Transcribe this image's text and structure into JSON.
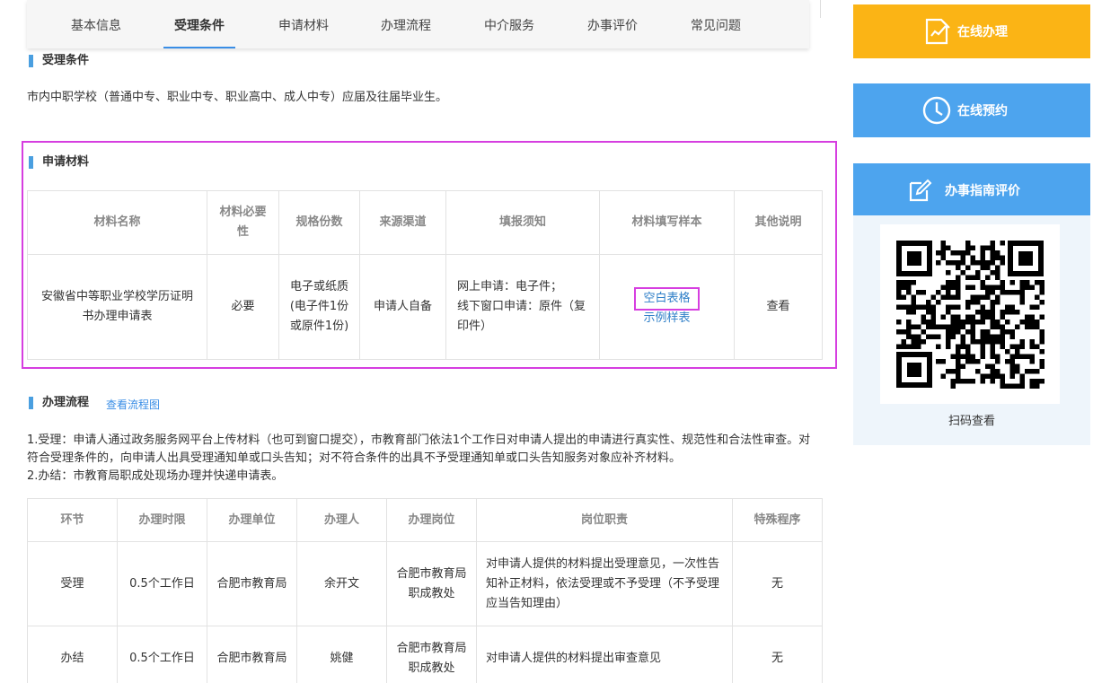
{
  "tabs": [
    "基本信息",
    "受理条件",
    "申请材料",
    "办理流程",
    "中介服务",
    "办事评价",
    "常见问题"
  ],
  "conditions": {
    "title": "受理条件",
    "text": "市内中职学校（普通中专、职业中专、职业高中、成人中专）应届及往届毕业生。"
  },
  "materials": {
    "title": "申请材料",
    "headers": [
      "材料名称",
      "材料必要性",
      "规格份数",
      "来源渠道",
      "填报须知",
      "材料填写样本",
      "其他说明"
    ],
    "row": {
      "name": "安徽省中等职业学校学历证明书办理申请表",
      "necessity": "必要",
      "spec": "电子或纸质(电子件1份或原件1份)",
      "source": "申请人自备",
      "notice_line1": "网上申请：电子件；",
      "notice_line2": "线下窗口申请：原件（复印件）",
      "sample_blank": "空白表格",
      "sample_example": "示例样表",
      "other": "查看"
    }
  },
  "process": {
    "title": "办理流程",
    "view_link": "查看流程图",
    "line1": "1.受理：申请人通过政务服务网平台上传材料（也可到窗口提交），市教育部门依法1个工作日对申请人提出的申请进行真实性、规范性和合法性审查。对符合受理条件的，向申请人出具受理通知单或口头告知；对不符合条件的出具不予受理通知单或口头告知服务对象应补齐材料。",
    "line2": "2.办结：市教育局职成处现场办理并快递申请表。",
    "headers": [
      "环节",
      "办理时限",
      "办理单位",
      "办理人",
      "办理岗位",
      "岗位职责",
      "特殊程序"
    ],
    "rows": [
      {
        "step": "受理",
        "time": "0.5个工作日",
        "unit": "合肥市教育局",
        "person": "余开文",
        "post": "合肥市教育局职成教处",
        "duty": "对申请人提供的材料提出受理意见，一次性告知补正材料，依法受理或不予受理（不予受理应当告知理由）",
        "special": "无"
      },
      {
        "step": "办结",
        "time": "0.5个工作日",
        "unit": "合肥市教育局",
        "person": "姚健",
        "post": "合肥市教育局职成教处",
        "duty": "对申请人提供的材料提出审查意见",
        "special": "无"
      }
    ]
  },
  "sidebar": {
    "online_handle": "在线办理",
    "online_booking": "在线预约",
    "guide_eval": "办事指南评价",
    "qr_caption": "扫码查看"
  },
  "colors": {
    "accent_blue": "#4da4ee",
    "accent_yellow": "#fbb415",
    "highlight": "#d63ee0",
    "link": "#2f7fc8"
  }
}
